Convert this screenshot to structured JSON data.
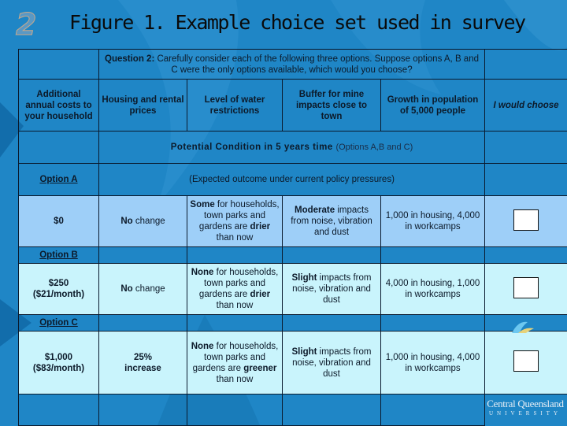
{
  "slide": {
    "number": "2",
    "title": "Figure 1. Example choice set used in survey"
  },
  "question": {
    "label": "Question 2:",
    "text": "Carefully consider each of the following three options.  Suppose options A, B and C were the only options available, which would you choose?"
  },
  "columns": {
    "cost": "Additional annual costs to your household",
    "housing": "Housing and rental prices",
    "water": "Level of water restrictions",
    "buffer": "Buffer for mine impacts close to town",
    "growth": "Growth in population of 5,000 people",
    "choose": "I would choose"
  },
  "condition": {
    "title": "Potential Condition in 5 years time",
    "subtitle": "(Options A,B and C)"
  },
  "options": [
    {
      "label": "Option A",
      "note": "(Expected outcome under current policy pressures)",
      "cost": "$0",
      "housing_bold": "No",
      "housing_rest": " change",
      "water_bold1": "Some",
      "water_mid": " for households, town parks and gardens are ",
      "water_bold2": "drier",
      "water_end": " than now",
      "buffer_bold": "Moderate",
      "buffer_rest": "  impacts from noise, vibration and dust",
      "growth": "1,000 in housing, 4,000 in workcamps",
      "selected": false
    },
    {
      "label": "Option B",
      "cost_line1": "$250",
      "cost_line2": "($21/month)",
      "housing_bold": "No",
      "housing_rest": " change",
      "water_bold1": "None",
      "water_mid": " for households, town parks and gardens are ",
      "water_bold2": "drier",
      "water_end": " than now",
      "buffer_bold": "Slight",
      "buffer_rest": " impacts from noise, vibration and dust",
      "growth": "4,000 in housing, 1,000 in workcamps",
      "selected": false
    },
    {
      "label": "Option C",
      "cost_line1": "$1,000",
      "cost_line2": "($83/month)",
      "housing_line1": "25%",
      "housing_line2": "increase",
      "water_bold1": "None",
      "water_mid": " for households, town parks and gardens are ",
      "water_bold2": "greener",
      "water_end": " than now",
      "buffer_bold": "Slight",
      "buffer_rest": " impacts from noise, vibration and dust",
      "growth": "1,000 in housing, 4,000 in workcamps",
      "selected": false
    }
  ],
  "logo": {
    "line1": "Central Queensland",
    "line2": "UNIVERSITY"
  },
  "colors": {
    "background": "#1f86c6",
    "condition_title": "#7b1050",
    "option_a_fill": "#9ecff8",
    "option_bc_fill": "#c9f4fc"
  }
}
